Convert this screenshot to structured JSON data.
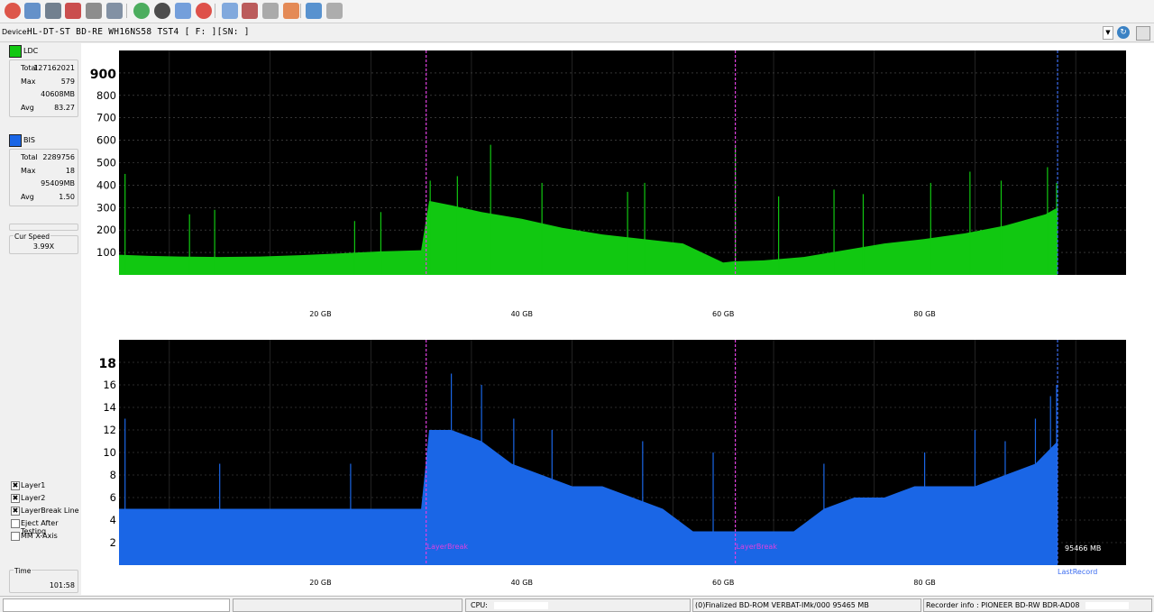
{
  "toolbar": {
    "buttons": [
      "power-icon",
      "disc-info-icon",
      "drive-icon",
      "erase-disc-icon",
      "burn-disc-icon",
      "copy-disc-icon",
      "refresh-icon",
      "scan-icon",
      "verify-icon",
      "stop-icon",
      "test-icon",
      "save-icon",
      "clean-icon",
      "burn-test-icon",
      "chart-icon",
      "eject-icon"
    ]
  },
  "device": {
    "label": "Device:",
    "value": "HL-DT-ST BD-RE  WH16NS58  TST4 [ F: ][SN:            ]"
  },
  "ldc": {
    "legend": "LDC",
    "color": "#11c811",
    "total_label": "Total",
    "total": "127162021",
    "max_label": "Max",
    "max": "579",
    "max_pos": "40608MB",
    "avg_label": "Avg",
    "avg": "83.27"
  },
  "bis": {
    "legend": "BIS",
    "color": "#1a66e6",
    "total_label": "Total",
    "total": "2289756",
    "max_label": "Max",
    "max": "18",
    "max_pos": "95409MB",
    "avg_label": "Avg",
    "avg": "1.50"
  },
  "speed": {
    "label": "Cur Speed",
    "value": "3.99X",
    "progress_fraction": 0
  },
  "options": [
    {
      "label": "Layer1",
      "checked": true
    },
    {
      "label": "Layer2",
      "checked": true
    },
    {
      "label": "LayerBreak Line",
      "checked": true
    },
    {
      "label": "Eject After Testing",
      "checked": false
    },
    {
      "label": "MM X-Axis",
      "checked": false
    }
  ],
  "time": {
    "label": "Time",
    "value": "101:58"
  },
  "status": {
    "cpu_label": "CPU:",
    "disc": "(0)Finalized  BD-ROM  VERBAT-IMk/000  95465 MB",
    "recorder": "Recorder info : PIONEER     BD-RW   BDR-AD08"
  },
  "chart_data": [
    {
      "type": "area",
      "name": "LDC",
      "x_unit": "GB",
      "xlim": [
        0,
        100
      ],
      "ylim": [
        0,
        1000
      ],
      "y_ticks": [
        100,
        200,
        300,
        400,
        500,
        600,
        700,
        800,
        900
      ],
      "x_tick_labels": [
        "20 GB",
        "40 GB",
        "60 GB",
        "80 GB"
      ],
      "x_ticks": [
        20,
        40,
        60,
        80
      ],
      "layer_breaks": [
        30.5,
        61.2
      ],
      "last_record": 93.2,
      "grid": true,
      "color": "#11c811",
      "x": [
        0,
        3,
        6,
        10,
        14,
        18,
        22,
        26,
        30,
        30.8,
        33,
        36,
        40,
        44,
        48,
        52,
        56,
        60,
        61,
        64,
        68,
        72,
        76,
        80,
        84,
        88,
        92,
        93.2
      ],
      "values": [
        90,
        85,
        82,
        80,
        82,
        88,
        96,
        105,
        110,
        330,
        310,
        280,
        250,
        210,
        180,
        160,
        140,
        55,
        60,
        65,
        80,
        110,
        140,
        160,
        185,
        220,
        270,
        300
      ],
      "spikes_x": [
        0.6,
        7,
        9.5,
        23.4,
        26,
        30.9,
        33.6,
        36.9,
        42,
        50.5,
        52.2,
        61.2,
        65.5,
        71,
        73.9,
        80.6,
        84.5,
        87.6,
        92.2,
        93.1
      ],
      "spikes_y": [
        450,
        270,
        290,
        240,
        280,
        420,
        440,
        580,
        410,
        370,
        410,
        580,
        350,
        380,
        360,
        410,
        460,
        420,
        480,
        410
      ]
    },
    {
      "type": "area",
      "name": "BIS",
      "x_unit": "GB",
      "xlim": [
        0,
        100
      ],
      "ylim": [
        0,
        20
      ],
      "y_ticks": [
        2,
        4,
        6,
        8,
        10,
        12,
        14,
        16,
        18
      ],
      "x_tick_labels": [
        "20 GB",
        "40 GB",
        "60 GB",
        "80 GB"
      ],
      "x_ticks": [
        20,
        40,
        60,
        80
      ],
      "layer_breaks": [
        30.5,
        61.2
      ],
      "last_record": 93.2,
      "grid": true,
      "color": "#1a66e6",
      "x": [
        0,
        4,
        8,
        12,
        16,
        20,
        24,
        28,
        30,
        30.8,
        33,
        36,
        39,
        42,
        45,
        48,
        51,
        54,
        57,
        60,
        61.5,
        64,
        67,
        70,
        73,
        76,
        79,
        82,
        85,
        88,
        91,
        93.2
      ],
      "values": [
        5,
        5,
        5,
        5,
        5,
        5,
        5,
        5,
        5,
        12,
        12,
        11,
        9,
        8,
        7,
        7,
        6,
        5,
        3,
        3,
        3,
        3,
        3,
        5,
        6,
        6,
        7,
        7,
        7,
        8,
        9,
        11
      ],
      "spikes_x": [
        0.6,
        10,
        23,
        30.9,
        33,
        36,
        39.2,
        43,
        52,
        59,
        70,
        80,
        85,
        88,
        91,
        92.5,
        93.1
      ],
      "spikes_y": [
        13,
        9,
        9,
        9,
        17,
        16,
        13,
        12,
        11,
        10,
        9,
        10,
        12,
        11,
        13,
        15,
        16
      ],
      "break_label": "LayerBreak",
      "end_label": "95466 MB",
      "last_record_label": "LastRecord"
    }
  ]
}
